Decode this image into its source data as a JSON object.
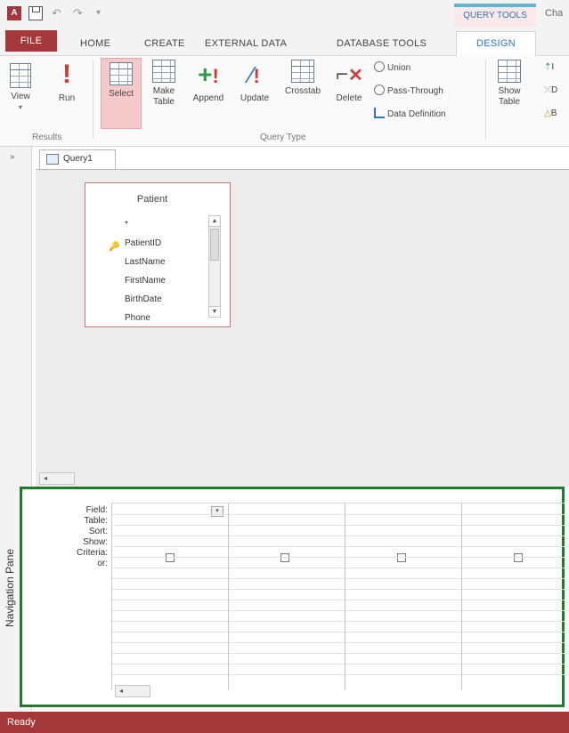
{
  "title_bar": {
    "context_tab": "QUERY TOOLS",
    "title_truncated": "Cha"
  },
  "tabs": [
    {
      "label": "FILE"
    },
    {
      "label": "HOME"
    },
    {
      "label": "CREATE"
    },
    {
      "label": "EXTERNAL DATA"
    },
    {
      "label": "DATABASE TOOLS"
    },
    {
      "label": "DESIGN"
    }
  ],
  "ribbon": {
    "results": {
      "label": "Results",
      "view": "View",
      "run": "Run"
    },
    "query_type": {
      "label": "Query Type",
      "select": "Select",
      "make_table_1": "Make",
      "make_table_2": "Table",
      "append": "Append",
      "update": "Update",
      "crosstab": "Crosstab",
      "delete": "Delete",
      "union": "Union",
      "pass_through": "Pass-Through",
      "data_definition": "Data Definition"
    },
    "query_setup": {
      "show_table_1": "Show",
      "show_table_2": "Table",
      "trunc_1": "I",
      "trunc_2": "D",
      "trunc_3": "B"
    }
  },
  "nav_pane": {
    "label": "Navigation Pane",
    "toggle": "»"
  },
  "document_tab": {
    "label": "Query1"
  },
  "patient_table": {
    "title": "Patient",
    "fields": [
      "*",
      "PatientID",
      "LastName",
      "FirstName",
      "BirthDate",
      "Phone"
    ]
  },
  "qbe_grid": {
    "row_labels": [
      "Field:",
      "Table:",
      "Sort:",
      "Show:",
      "Criteria:",
      "or:"
    ]
  },
  "status_bar": {
    "text": "Ready"
  },
  "colors": {
    "accent": "#a4373a",
    "highlight_frame": "#1e7a2c",
    "query_tools_bar": "#68b3c7"
  }
}
